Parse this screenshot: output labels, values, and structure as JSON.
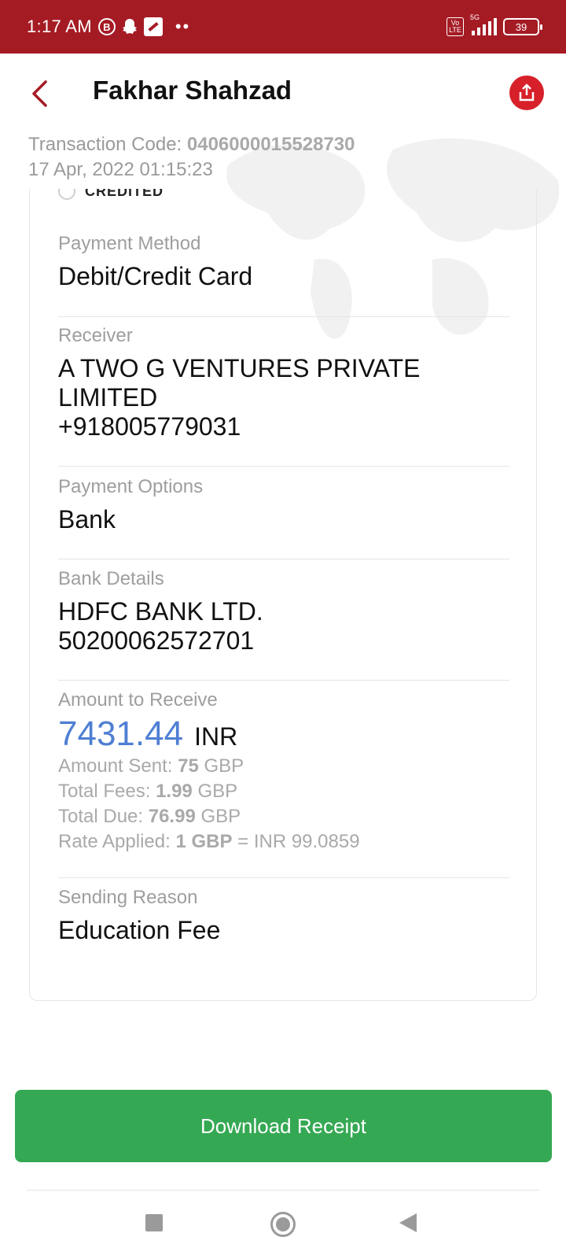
{
  "status_bar": {
    "time": "1:17 AM",
    "notification_letter": "B",
    "network": "5G",
    "volte": "Vo LTE",
    "battery": "39"
  },
  "header": {
    "title": "Fakhar Shahzad",
    "back_icon": "chevron-left-icon",
    "share_icon": "share-icon"
  },
  "transaction": {
    "code_label": "Transaction Code: ",
    "code_value": "0406000015528730",
    "datetime": "17 Apr, 2022 01:15:23"
  },
  "status_option": {
    "label": "CREDITED"
  },
  "details": {
    "payment_method": {
      "label": "Payment Method",
      "value": "Debit/Credit Card"
    },
    "receiver": {
      "label": "Receiver",
      "name_line1": "A TWO G VENTURES PRIVATE",
      "name_line2": "LIMITED",
      "phone": "+918005779031"
    },
    "payment_options": {
      "label": "Payment Options",
      "value": "Bank"
    },
    "bank_details": {
      "label": "Bank Details",
      "bank_name": "HDFC BANK LTD.",
      "account_number": "50200062572701"
    },
    "amount": {
      "label": "Amount to Receive",
      "value": "7431.44",
      "currency": "INR",
      "sent_label": "Amount Sent: ",
      "sent_value": "75",
      "sent_currency": " GBP",
      "fees_label": "Total Fees: ",
      "fees_value": "1.99",
      "fees_currency": " GBP",
      "due_label": "Total Due: ",
      "due_value": "76.99",
      "due_currency": " GBP",
      "rate_label": "Rate Applied: ",
      "rate_value": "1 GBP",
      "rate_rest": " = INR 99.0859"
    },
    "sending_reason": {
      "label": "Sending Reason",
      "value": "Education Fee"
    }
  },
  "actions": {
    "download_label": "Download Receipt"
  },
  "colors": {
    "status_bar": "#a51b24",
    "accent_red": "#d7202a",
    "amount_blue": "#4f7fd3",
    "button_green": "#35a853"
  }
}
